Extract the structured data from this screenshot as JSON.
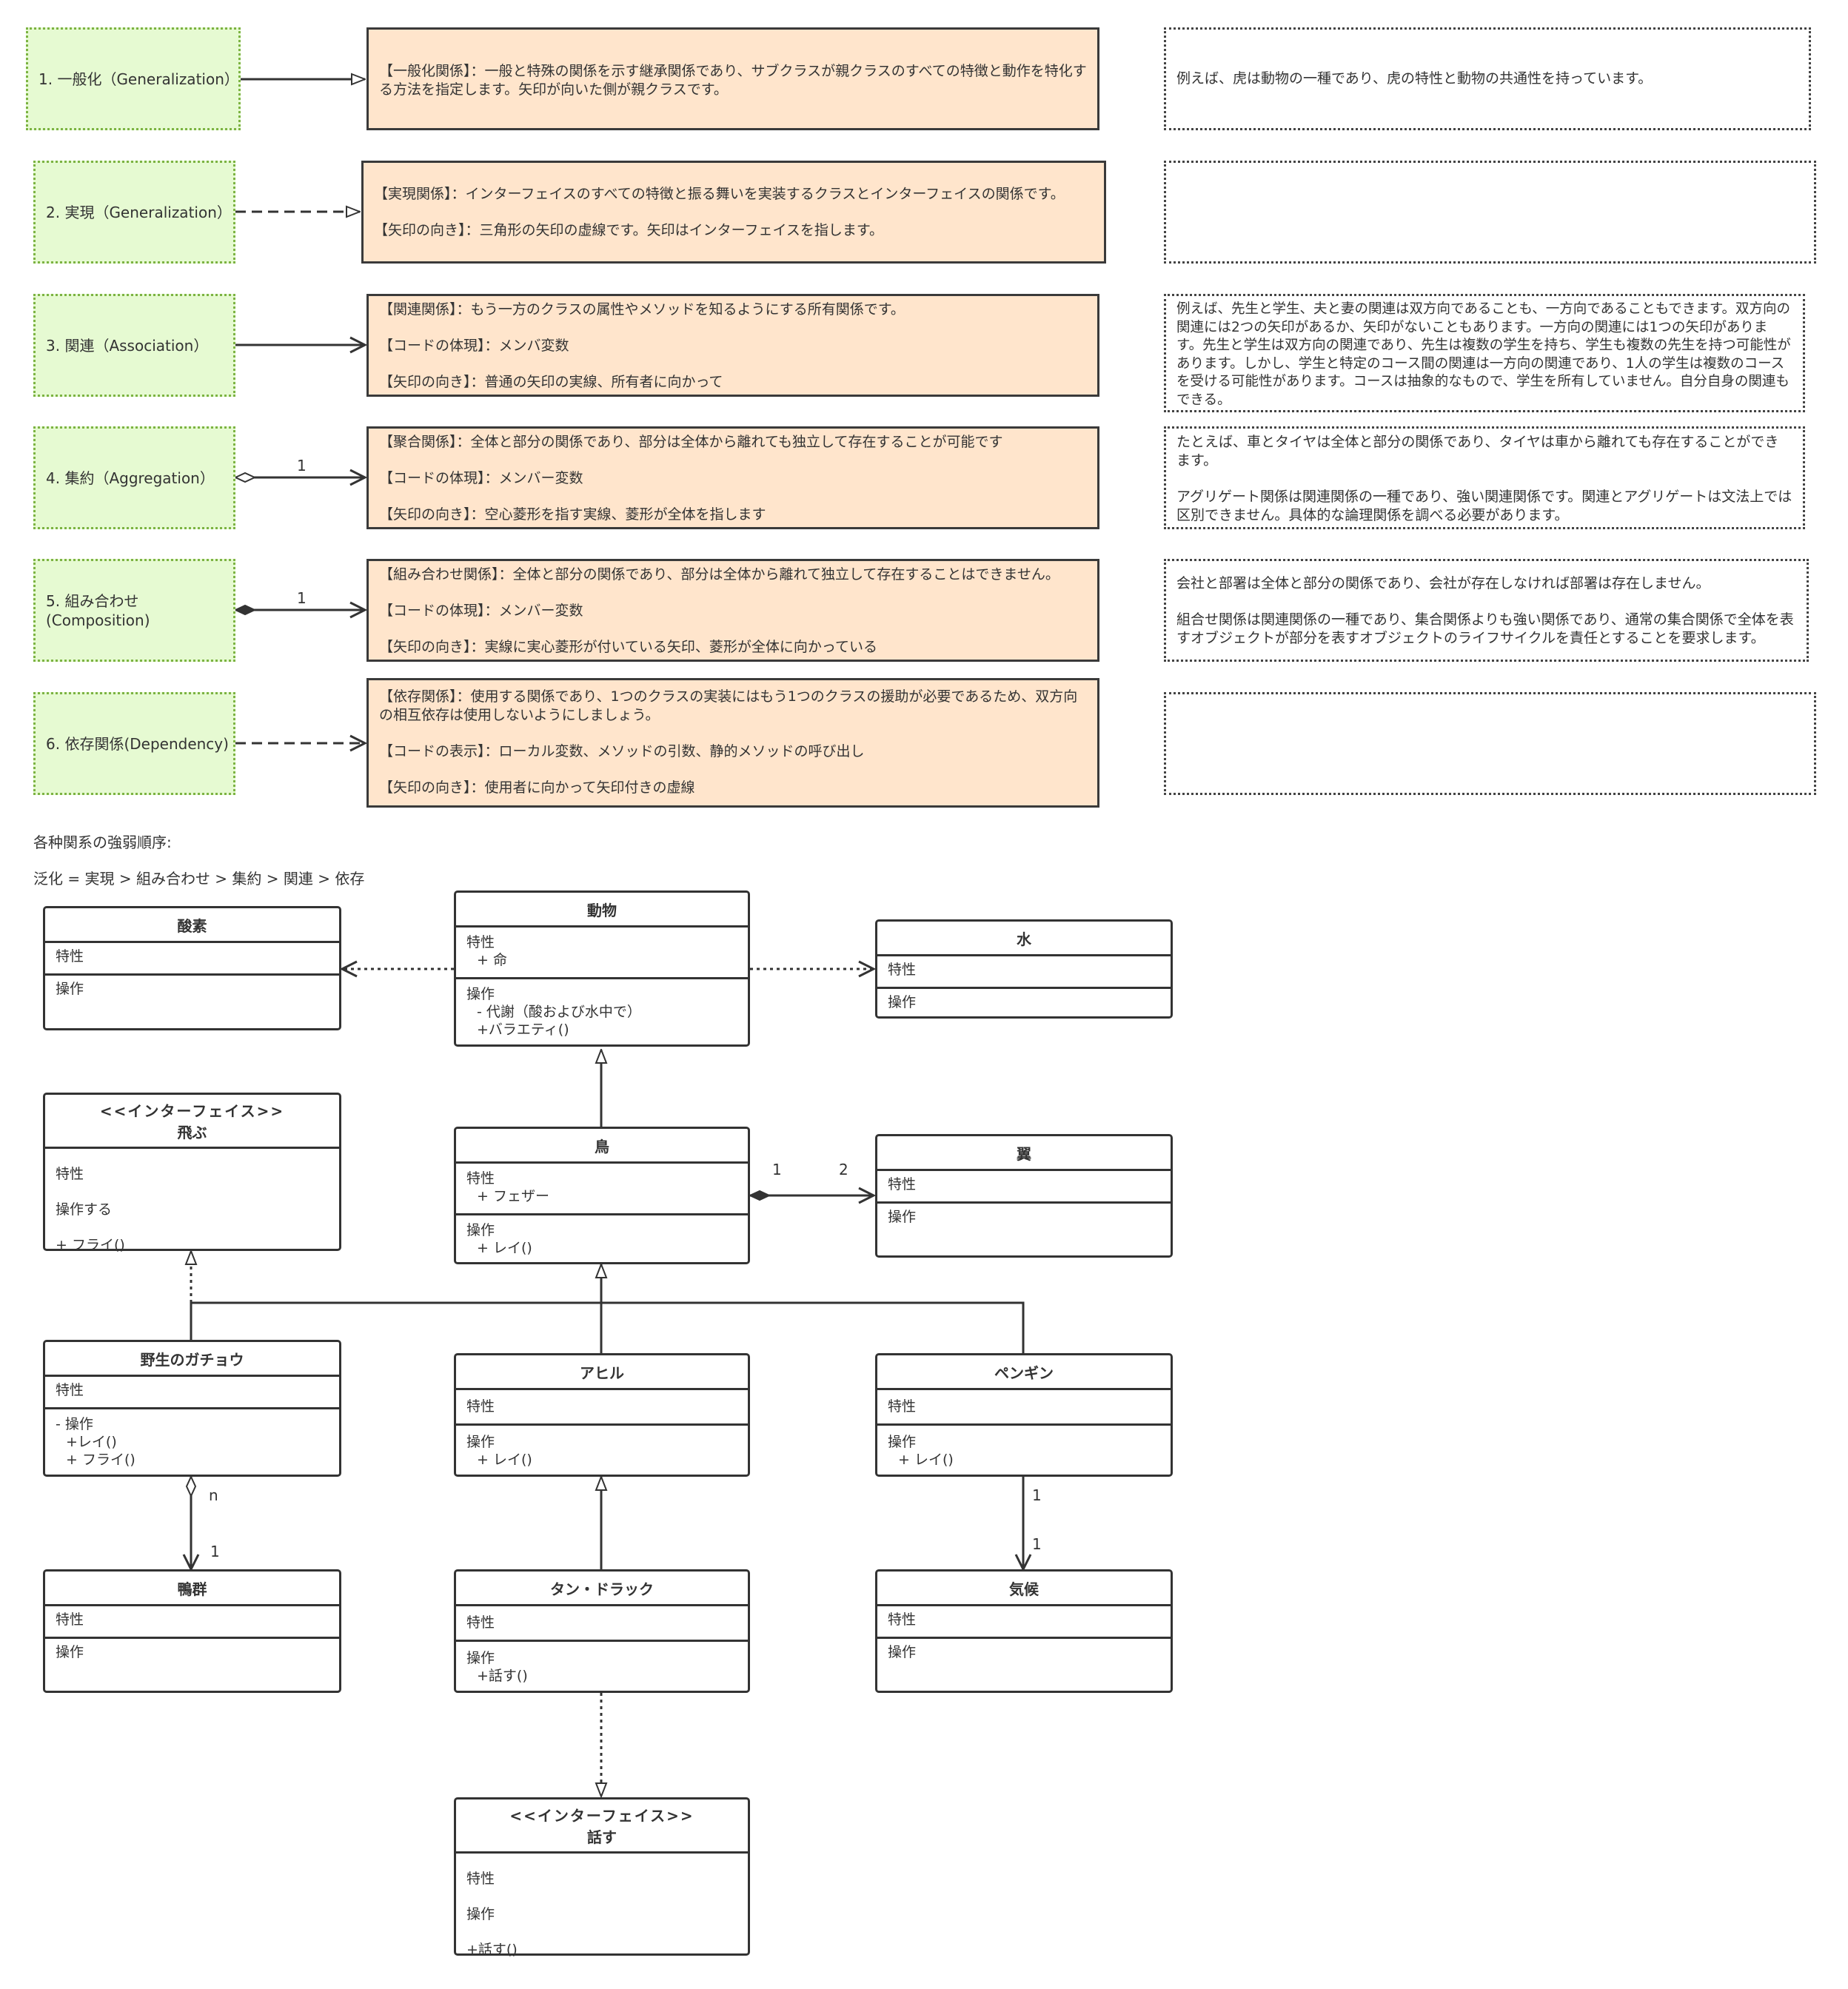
{
  "relations": [
    {
      "name": "1. 一般化（Generalization）",
      "desc": [
        "【一般化関係】：一般と特殊の関係を示す継承関係であり、サブクラスが親クラスのすべての特徴と動作を特化する方法を指定します。矢印が向いた側が親クラスです。"
      ],
      "note": [
        "例えば、虎は動物の一種であり、虎の特性と動物の共通性を持っています。"
      ]
    },
    {
      "name": "2. 実現（Generalization）",
      "desc": [
        "【実現関係】：インターフェイスのすべての特徴と振る舞いを実装するクラスとインターフェイスの関係です。",
        "【矢印の向き】：三角形の矢印の虚線です。矢印はインターフェイスを指します。"
      ],
      "note": []
    },
    {
      "name": "3. 関連（Association）",
      "desc": [
        "【関連関係】：もう一方のクラスの属性やメソッドを知るようにする所有関係です。",
        "【コードの体現】：メンバ変数",
        "【矢印の向き】：普通の矢印の実線、所有者に向かって"
      ],
      "note": [
        "例えば、先生と学生、夫と妻の関連は双方向であることも、一方向であることもできます。双方向の関連には2つの矢印があるか、矢印がないこともあります。一方向の関連には1つの矢印があります。先生と学生は双方向の関連であり、先生は複数の学生を持ち、学生も複数の先生を持つ可能性があります。しかし、学生と特定のコース間の関連は一方向の関連であり、1人の学生は複数のコースを受ける可能性があります。コースは抽象的なもので、学生を所有していません。自分自身の関連もできる。"
      ]
    },
    {
      "name": "4. 集約（Aggregation）",
      "desc": [
        "【聚合関係】：全体と部分の関係であり、部分は全体から離れても独立して存在することが可能です",
        "【コードの体現】：メンバー変数",
        "【矢印の向き】：空心菱形を指す実線、菱形が全体を指します"
      ],
      "note": [
        "たとえば、車とタイヤは全体と部分の関係であり、タイヤは車から離れても存在することができます。",
        "アグリゲート関係は関連関係の一種であり、強い関連関係です。関連とアグリゲートは文法上では区別できません。具体的な論理関係を調べる必要があります。"
      ],
      "mult": "1"
    },
    {
      "name": "5. 組み合わせ\n(Composition)",
      "desc": [
        "【組み合わせ関係】：全体と部分の関係であり、部分は全体から離れて独立して存在することはできません。",
        "【コードの体現】：メンバー変数",
        "【矢印の向き】：実線に実心菱形が付いている矢印、菱形が全体に向かっている"
      ],
      "note": [
        "会社と部署は全体と部分の関係であり、会社が存在しなければ部署は存在しません。",
        "組合せ関係は関連関係の一種であり、集合関係よりも強い関係であり、通常の集合関係で全体を表すオブジェクトが部分を表すオブジェクトのライフサイクルを責任とすることを要求します。"
      ],
      "mult": "1"
    },
    {
      "name": "6. 依存関係(Dependency)",
      "desc": [
        "【依存関係】：使用する関係であり、1つのクラスの実装にはもう1つのクラスの援助が必要であるため、双方向の相互依存は使用しないようにしましょう。",
        "【コードの表示】：ローカル変数、メソッドの引数、静的メソッドの呼び出し",
        "【矢印の向き】：使用者に向かって矢印付きの虚線"
      ],
      "note": []
    }
  ],
  "order_title": "各种関系の強弱順序:",
  "order_text": "泛化 = 実現 > 組み合わせ > 集約 > 関連 > 依存",
  "classes": {
    "oxygen": {
      "title": "酸素",
      "attr": "特性",
      "ops": "操作"
    },
    "animal": {
      "title": "動物",
      "attr": "特性",
      "attr_items": [
        "+ 命"
      ],
      "ops": "操作",
      "op_items": [
        "- 代謝（酸および水中で）",
        "+バラエティ()"
      ]
    },
    "water": {
      "title": "水",
      "attr": "特性",
      "ops": "操作"
    },
    "fly": {
      "stereo": "<<インターフェイス>>",
      "title": "飛ぶ",
      "attr": "特性",
      "ops": "操作する",
      "op_items": [
        "+ フライ()"
      ]
    },
    "bird": {
      "title": "鳥",
      "attr": "特性",
      "attr_items": [
        "+ フェザー"
      ],
      "ops": "操作",
      "op_items": [
        "+ レイ()"
      ]
    },
    "wing": {
      "title": "翼",
      "attr": "特性",
      "ops": "操作"
    },
    "goose": {
      "title": "野生のガチョウ",
      "attr": "特性",
      "ops": "- 操作",
      "op_items": [
        "+レイ()",
        "+ フライ()"
      ]
    },
    "duck": {
      "title": "アヒル",
      "attr": "特性",
      "ops": "操作",
      "op_items": [
        "+ レイ()"
      ]
    },
    "penguin": {
      "title": "ペンギン",
      "attr": "特性",
      "ops": "操作",
      "op_items": [
        "+ レイ()"
      ]
    },
    "flock": {
      "title": "鴨群",
      "attr": "特性",
      "ops": "操作"
    },
    "tangduck": {
      "title": "タン・ドラック",
      "attr": "特性",
      "ops": "操作",
      "op_items": [
        "+話す()"
      ]
    },
    "climate": {
      "title": "気候",
      "attr": "特性",
      "ops": "操作"
    },
    "speak": {
      "stereo": "<<インターフェイス>>",
      "title": "話す",
      "attr": "特性",
      "ops": "操作",
      "op_items": [
        "+話す()"
      ]
    }
  },
  "multiplicities": {
    "bird_wing_a": "1",
    "bird_wing_b": "2",
    "goose_flock_a": "n",
    "goose_flock_b": "1",
    "penguin_climate_a": "1",
    "penguin_climate_b": "1"
  }
}
